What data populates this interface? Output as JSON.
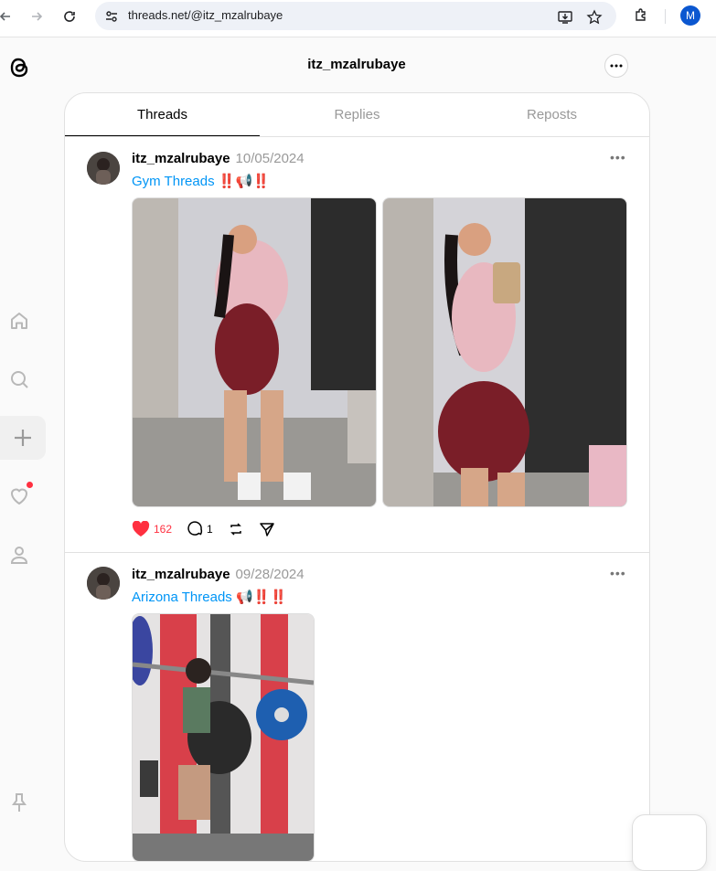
{
  "browser": {
    "url": "threads.net/@itz_mzalrubaye",
    "profile_initial": "M"
  },
  "header": {
    "title": "itz_mzalrubaye"
  },
  "tabs": [
    {
      "label": "Threads",
      "active": true
    },
    {
      "label": "Replies",
      "active": false
    },
    {
      "label": "Reposts",
      "active": false
    }
  ],
  "posts": [
    {
      "username": "itz_mzalrubaye",
      "date": "10/05/2024",
      "tag": "Gym Threads",
      "caption_suffix": " ‼️📢‼️",
      "likes": "162",
      "replies": "1",
      "liked": true
    },
    {
      "username": "itz_mzalrubaye",
      "date": "09/28/2024",
      "tag": "Arizona Threads",
      "caption_suffix": " 📢‼️‼️"
    }
  ],
  "colors": {
    "accent": "#0095f6",
    "like": "#ff3040"
  }
}
